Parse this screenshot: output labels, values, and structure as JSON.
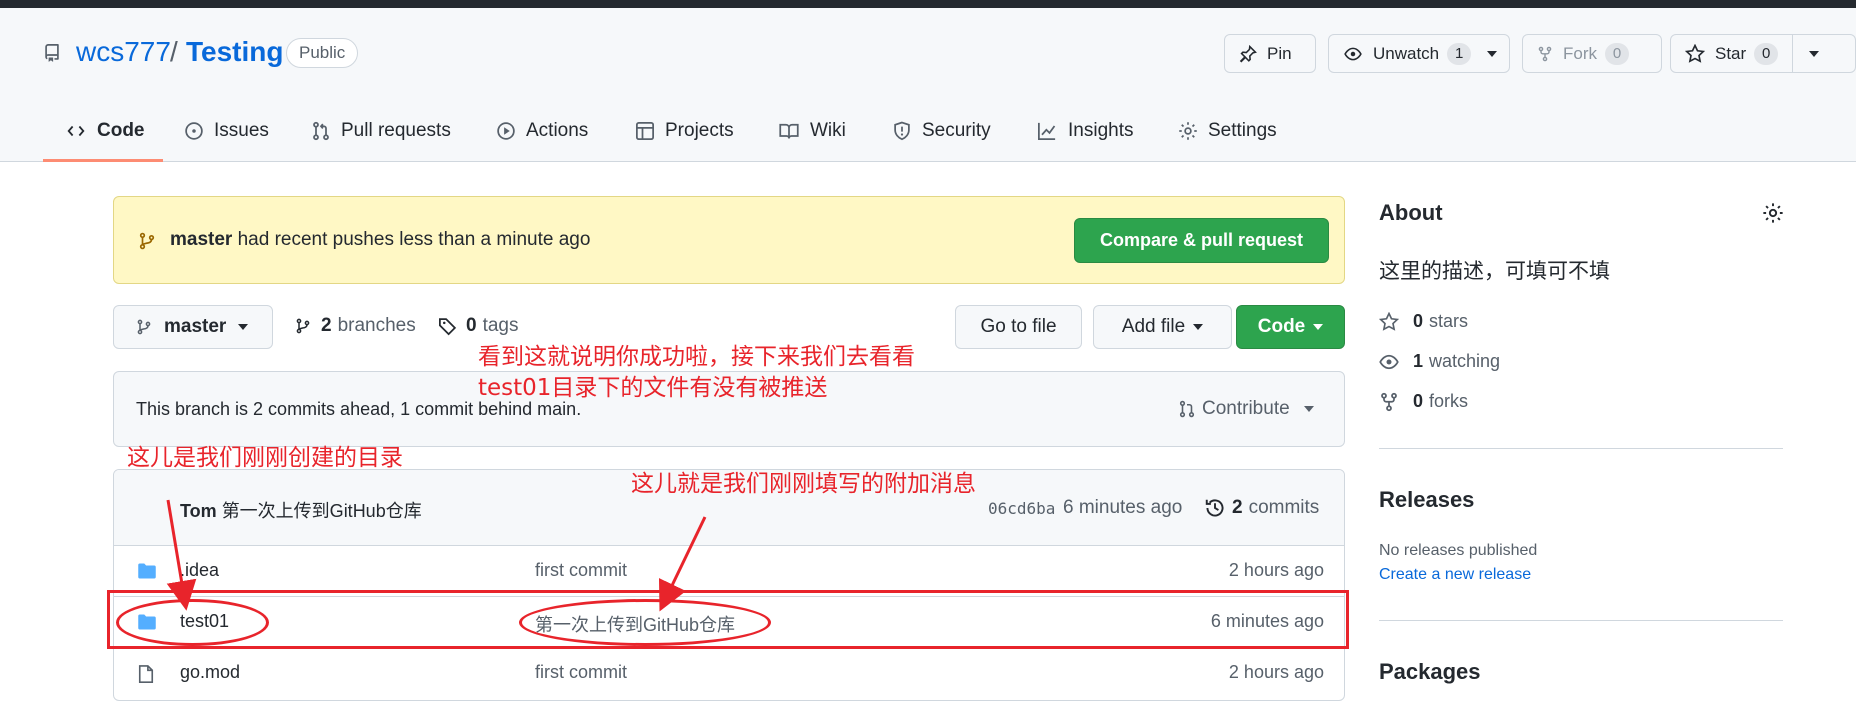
{
  "header": {
    "owner": "wcs777",
    "separator": "/",
    "repo": "Testing",
    "visibility": "Public",
    "pin_label": "Pin",
    "unwatch_label": "Unwatch",
    "unwatch_count": "1",
    "fork_label": "Fork",
    "fork_count": "0",
    "star_label": "Star",
    "star_count": "0"
  },
  "tabs": [
    {
      "label": "Code",
      "icon": "code-icon"
    },
    {
      "label": "Issues",
      "icon": "issue-icon"
    },
    {
      "label": "Pull requests",
      "icon": "pull-request-icon"
    },
    {
      "label": "Actions",
      "icon": "play-icon"
    },
    {
      "label": "Projects",
      "icon": "table-icon"
    },
    {
      "label": "Wiki",
      "icon": "book-icon"
    },
    {
      "label": "Security",
      "icon": "shield-icon"
    },
    {
      "label": "Insights",
      "icon": "graph-icon"
    },
    {
      "label": "Settings",
      "icon": "gear-icon"
    }
  ],
  "flash": {
    "branch": "master",
    "text": "had recent pushes less than a minute ago",
    "button": "Compare & pull request"
  },
  "toolbar": {
    "branch": "master",
    "branches_count": "2",
    "branches_label": "branches",
    "tags_count": "0",
    "tags_label": "tags",
    "goto_file": "Go to file",
    "add_file": "Add file",
    "code": "Code"
  },
  "status": {
    "text": "This branch is 2 commits ahead, 1 commit behind main.",
    "contribute": "Contribute"
  },
  "commit": {
    "author": "Tom",
    "message": "第一次上传到GitHub仓库",
    "sha": "06cd6ba",
    "time": "6 minutes ago",
    "count": "2",
    "count_label": "commits"
  },
  "files": [
    {
      "name": ".idea",
      "type": "folder",
      "message": "first commit",
      "time": "2 hours ago"
    },
    {
      "name": "test01",
      "type": "folder",
      "message": "第一次上传到GitHub仓库",
      "time": "6 minutes ago"
    },
    {
      "name": "go.mod",
      "type": "file",
      "message": "first commit",
      "time": "2 hours ago"
    }
  ],
  "about": {
    "title": "About",
    "description": "这里的描述，可填可不填",
    "stars_count": "0",
    "stars_label": "stars",
    "watching_count": "1",
    "watching_label": "watching",
    "forks_count": "0",
    "forks_label": "forks"
  },
  "releases": {
    "title": "Releases",
    "none": "No releases published",
    "create": "Create a new release"
  },
  "packages": {
    "title": "Packages"
  },
  "annotations": {
    "success_line1": "看到这就说明你成功啦，接下来我们去看看",
    "success_line2": "test01目录下的文件有没有被推送",
    "dir_note": "这儿是我们刚刚创建的目录",
    "msg_note": "这儿就是我们刚刚填写的附加消息"
  },
  "colors": {
    "accent": "#0969da",
    "green": "#2da44e",
    "annotation": "#e8242b"
  }
}
